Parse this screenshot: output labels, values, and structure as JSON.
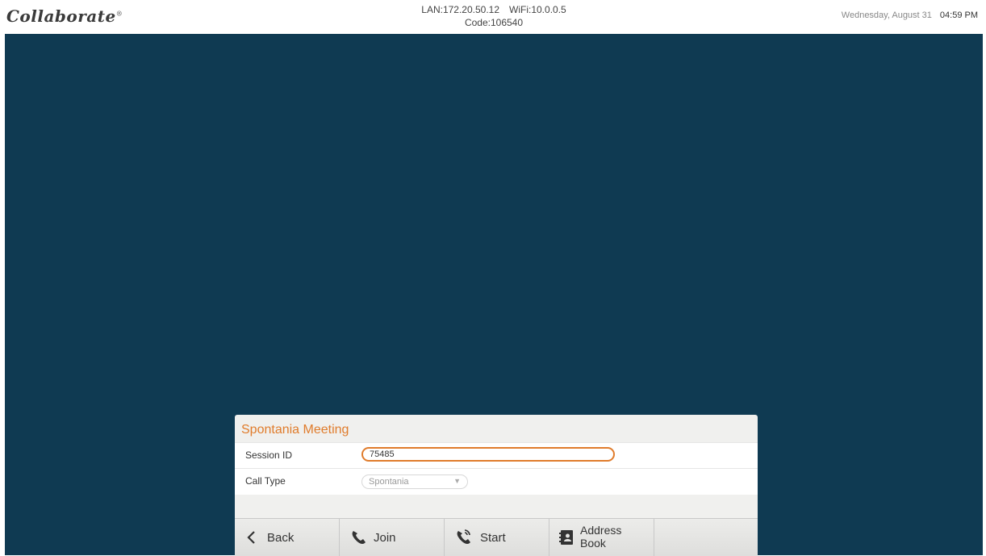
{
  "header": {
    "logo": "Collaborate",
    "logo_mark": "®",
    "lan": "LAN:172.20.50.12",
    "wifi": "WiFi:10.0.0.5",
    "code": "Code:106540",
    "date": "Wednesday, August 31",
    "time": "04:59 PM"
  },
  "panel": {
    "title": "Spontania Meeting",
    "session_label": "Session ID",
    "session_value": "75485",
    "calltype_label": "Call Type",
    "calltype_value": "Spontania"
  },
  "buttons": {
    "back": "Back",
    "join": "Join",
    "start": "Start",
    "address_line1": "Address",
    "address_line2": "Book"
  },
  "colors": {
    "accent": "#e07c2c",
    "background": "#0f3a52"
  },
  "icons": [
    "chevron-left-icon",
    "phone-icon",
    "phone-ring-icon",
    "address-book-icon",
    "caret-down-icon"
  ]
}
